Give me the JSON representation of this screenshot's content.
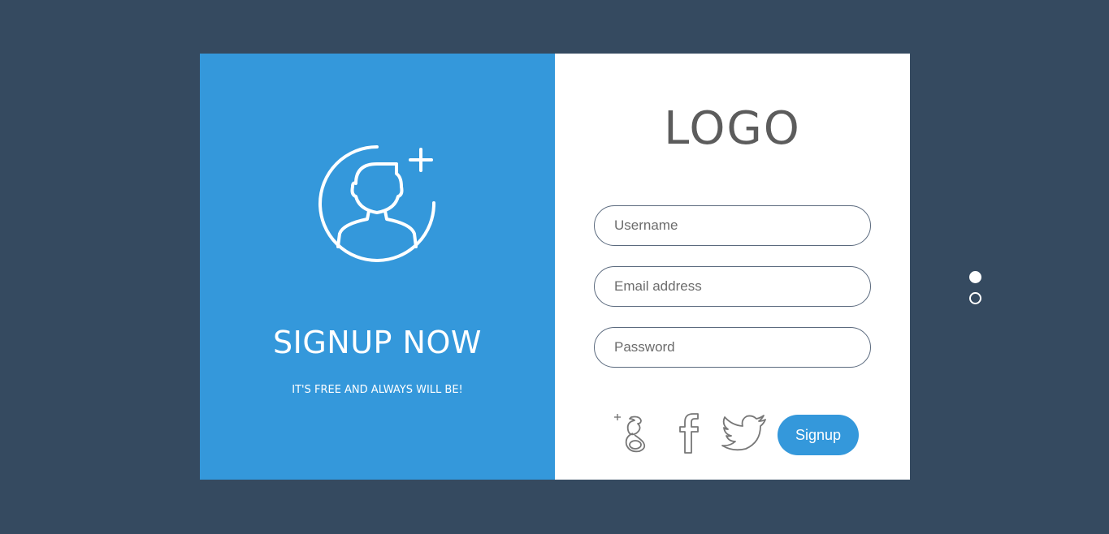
{
  "left_panel": {
    "heading": "SIGNUP NOW",
    "subheading": "IT'S FREE AND ALWAYS WILL BE!",
    "icon": "add-user-icon"
  },
  "right_panel": {
    "logo": "LOGO",
    "fields": {
      "username_placeholder": "Username",
      "email_placeholder": "Email address",
      "password_placeholder": "Password"
    },
    "social": [
      "google-plus-icon",
      "facebook-icon",
      "twitter-icon"
    ],
    "signup_label": "Signup"
  },
  "pager": {
    "count": 2,
    "active_index": 0
  },
  "colors": {
    "background": "#354a60",
    "accent": "#3498db",
    "panel": "#ffffff"
  }
}
